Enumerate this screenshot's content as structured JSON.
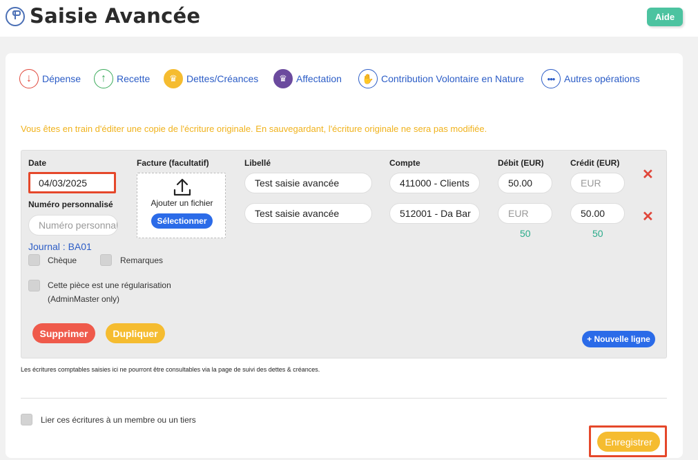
{
  "page": {
    "title": "Saisie Avancée",
    "help_label": "Aide"
  },
  "operation_types": [
    {
      "label": "Dépense",
      "icon": "arrow-down-icon",
      "color": "#e0463a"
    },
    {
      "label": "Recette",
      "icon": "arrow-up-icon",
      "color": "#3aaa5a"
    },
    {
      "label": "Dettes/Créances",
      "icon": "crown-icon",
      "color": "#f5bc30"
    },
    {
      "label": "Affectation",
      "icon": "crown-icon",
      "color": "#6b4a9e"
    },
    {
      "label": "Contribution Volontaire en Nature",
      "icon": "hand-icon",
      "color": "#2b5cc6"
    },
    {
      "label": "Autres opérations",
      "icon": "ellipsis-icon",
      "color": "#2b5cc6"
    }
  ],
  "notice": "Vous êtes en train d'éditer une copie de l'écriture originale. En sauvegardant, l'écriture originale ne sera pas modifiée.",
  "form": {
    "date_label": "Date",
    "date_value": "04/03/2025",
    "custom_number_label": "Numéro personnalisé",
    "custom_number_placeholder": "Numéro personnalisé",
    "invoice_label": "Facture (facultatif)",
    "upload_label": "Ajouter un fichier",
    "select_button": "Sélectionner",
    "journal": "Journal : BA01",
    "cheque_label": "Chèque",
    "remarks_label": "Remarques",
    "regularisation_label_1": "Cette pièce est une régularisation",
    "regularisation_label_2": "(AdminMaster only)",
    "columns": {
      "libelle": "Libellé",
      "compte": "Compte",
      "debit": "Débit (EUR)",
      "credit": "Crédit (EUR)"
    },
    "amount_placeholder": "EUR",
    "lines": [
      {
        "libelle": "Test saisie avancée",
        "compte": "411000 - Clients",
        "debit": "50.00",
        "credit": ""
      },
      {
        "libelle": "Test saisie avancée",
        "compte": "512001 - Da Bar",
        "debit": "",
        "credit": "50.00"
      }
    ],
    "totals": {
      "debit": "50",
      "credit": "50"
    },
    "delete_button": "Supprimer",
    "duplicate_button": "Dupliquer",
    "new_line_button": "+ Nouvelle ligne"
  },
  "footnote": "Les écritures comptables saisies ici ne pourront être consultables via la page de suivi des dettes & créances.",
  "link_label": "Lier ces écritures à un membre ou un tiers",
  "save_button": "Enregistrer"
}
